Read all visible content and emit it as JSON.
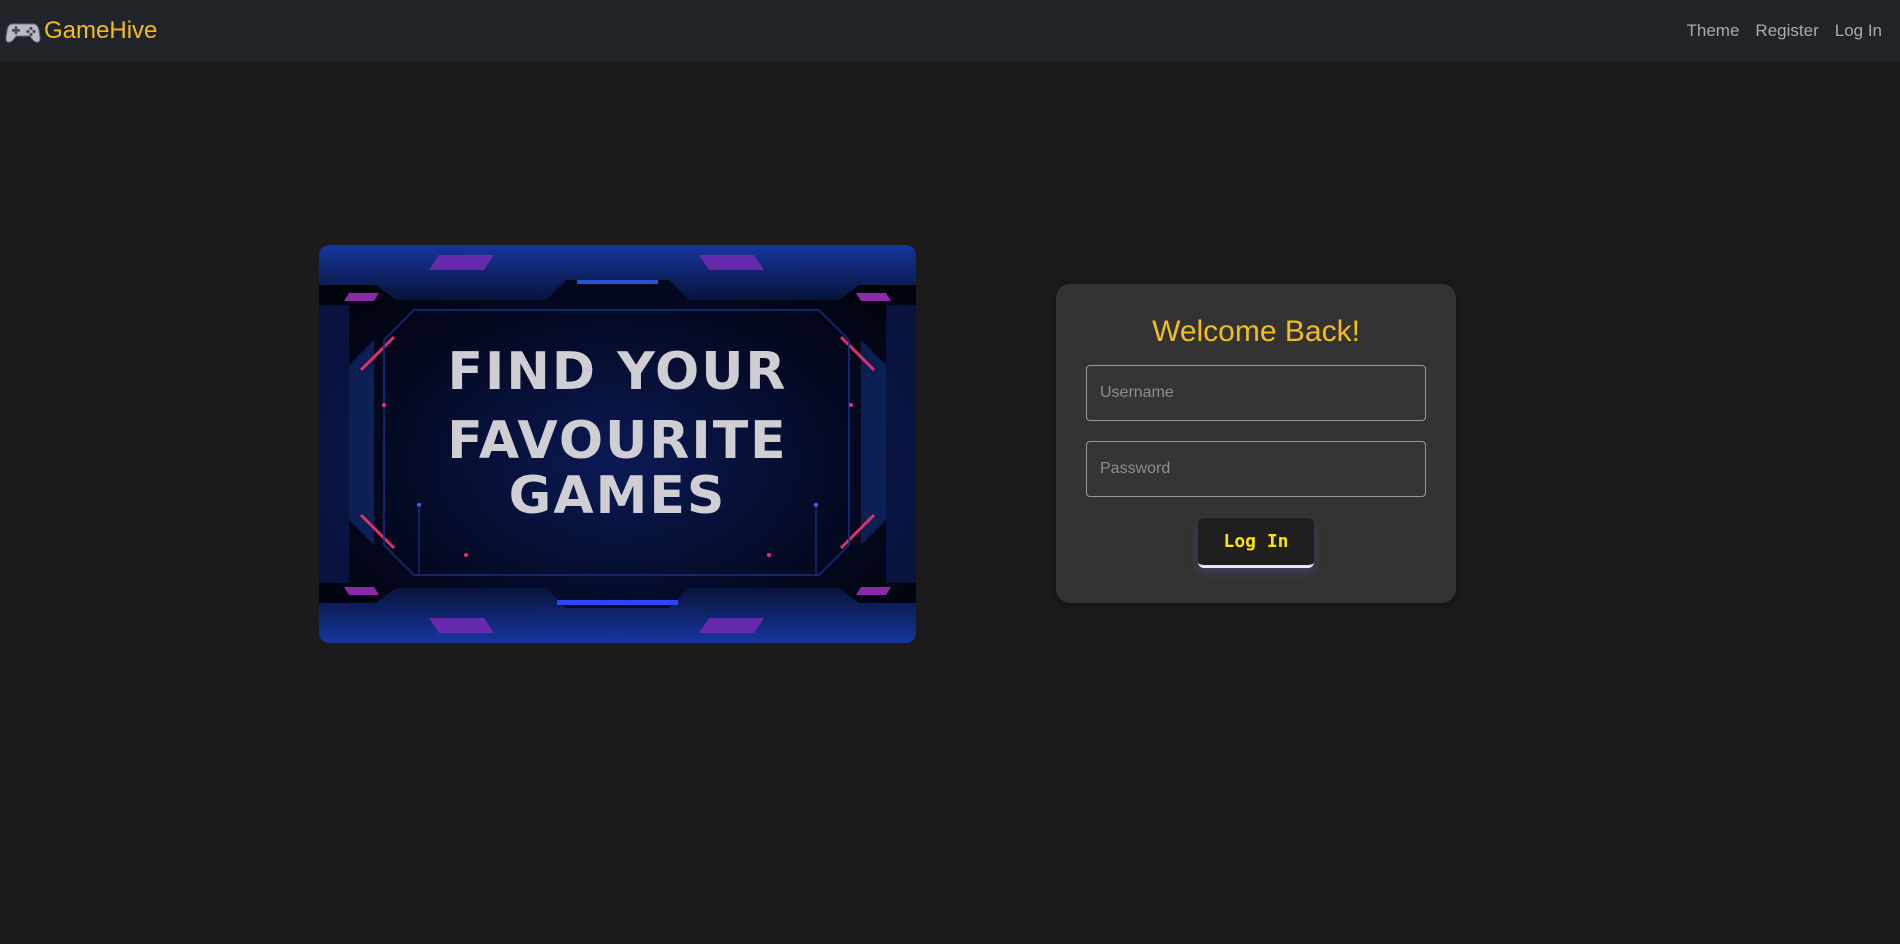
{
  "app": {
    "brand": "GameHive",
    "brand_icon": "game-controller-icon",
    "brand_color": "#f2bd1d"
  },
  "nav": {
    "items": [
      {
        "label": "Theme"
      },
      {
        "label": "Register"
      },
      {
        "label": "Log In"
      }
    ]
  },
  "hero": {
    "line1": "FIND YOUR",
    "line2": "FAVOURITE",
    "line3": "GAMES"
  },
  "login": {
    "title": "Welcome Back!",
    "username_placeholder": "Username",
    "password_placeholder": "Password",
    "submit_label": "Log In",
    "accent_color": "#f2bd1d",
    "button_text_color": "#ffe100"
  }
}
